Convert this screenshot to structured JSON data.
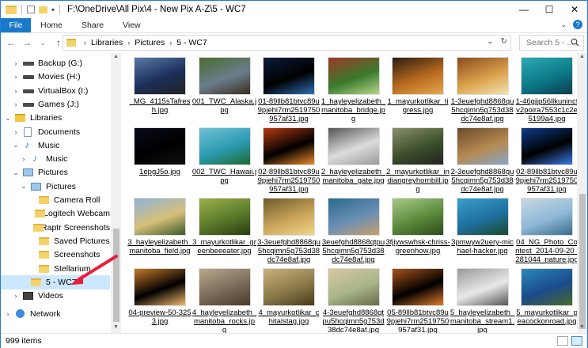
{
  "window": {
    "title": "F:\\OneDrive\\All Pix\\4 - New Pix A-Z\\5 - WC7",
    "minimize": "—",
    "maximize": "☐",
    "close": "✕"
  },
  "ribbon": {
    "tabs": [
      "File",
      "Home",
      "Share",
      "View"
    ]
  },
  "address": {
    "crumbs": [
      "Libraries",
      "Pictures",
      "5 - WC7"
    ],
    "search_placeholder": "Search 5 - ..."
  },
  "nav": {
    "items": [
      {
        "label": "Backup (G:)",
        "icon": "drive-icon",
        "chev": "›",
        "indent": 1
      },
      {
        "label": "Movies (H:)",
        "icon": "drive-icon",
        "chev": "›",
        "indent": 1
      },
      {
        "label": "VirtualBox (I:)",
        "icon": "drive-icon",
        "chev": "›",
        "indent": 1
      },
      {
        "label": "Games (J:)",
        "icon": "drive-icon",
        "chev": "›",
        "indent": 1
      },
      {
        "label": "Libraries",
        "icon": "libraries-icon",
        "chev": "⌄",
        "indent": 0
      },
      {
        "label": "Documents",
        "icon": "documents-icon",
        "chev": "›",
        "indent": 1
      },
      {
        "label": "Music",
        "icon": "music-icon",
        "chev": "⌄",
        "indent": 1
      },
      {
        "label": "Music",
        "icon": "music-icon",
        "chev": "›",
        "indent": 2
      },
      {
        "label": "Pictures",
        "icon": "pictures-icon",
        "chev": "⌄",
        "indent": 1
      },
      {
        "label": "Pictures",
        "icon": "pictures-icon",
        "chev": "⌄",
        "indent": 2
      },
      {
        "label": "Camera Roll",
        "icon": "folder-icon",
        "chev": "",
        "indent": 3
      },
      {
        "label": "Logitech Webcam",
        "icon": "folder-icon",
        "chev": "",
        "indent": 3
      },
      {
        "label": "Raptr Screenshots",
        "icon": "folder-icon",
        "chev": "",
        "indent": 3
      },
      {
        "label": "Saved Pictures",
        "icon": "folder-icon",
        "chev": "",
        "indent": 3
      },
      {
        "label": "Screenshots",
        "icon": "folder-icon",
        "chev": "",
        "indent": 3
      },
      {
        "label": "Stellarium",
        "icon": "folder-icon",
        "chev": "",
        "indent": 3
      },
      {
        "label": "5 - WC7",
        "icon": "folder-icon",
        "chev": "",
        "indent": 2,
        "selected": true
      },
      {
        "label": "Videos",
        "icon": "videos-icon",
        "chev": "›",
        "indent": 1
      },
      {
        "label": "Network",
        "icon": "network-icon",
        "chev": "›",
        "indent": 0
      }
    ]
  },
  "files": [
    {
      "name": "_MG_4115sTafresh.jpg",
      "colors": [
        "#1b2f5a",
        "#5a79a8",
        "#222"
      ]
    },
    {
      "name": "001_TWC_Alaska.jpg",
      "colors": [
        "#6a7d8c",
        "#4b6b2f",
        "#3a2e1e"
      ]
    },
    {
      "name": "01-89llb81btvc89u9pjehi7rm2519750957af31.jpg",
      "colors": [
        "#000",
        "#0c1d3d",
        "#2e6fb5"
      ]
    },
    {
      "name": "1_hayleyelizabeth_manitoba_bridge.jpg",
      "colors": [
        "#3a7a2c",
        "#9b3a2a",
        "#b7d68a"
      ]
    },
    {
      "name": "1_mayurkotlikar_tigress.jpg",
      "colors": [
        "#b86a1f",
        "#2a1c10",
        "#e6a94f"
      ]
    },
    {
      "name": "1-3euefghd8868qu5hcqimn5g753d38dc74e8af.jpg",
      "colors": [
        "#d9a14b",
        "#8c4a1e",
        "#f5e1b0"
      ]
    },
    {
      "name": "1-46gjip56llkunincfv2poira7553c1c2e5199a4.jpg",
      "colors": [
        "#0b7a86",
        "#2ea8b6",
        "#0f3b52"
      ]
    },
    {
      "name": "1epgJ5o.jpg",
      "colors": [
        "#000",
        "#0a0a1a",
        "#111"
      ]
    },
    {
      "name": "002_TWC_Hawaii.jpg",
      "colors": [
        "#2a9ab0",
        "#73c1d8",
        "#1d6b2f"
      ]
    },
    {
      "name": "02-89llb81btvc89u9pjehi7rm2519750957af31.jpg",
      "colors": [
        "#000",
        "#b43a12",
        "#ee8a2a"
      ]
    },
    {
      "name": "2_hayleyelizabeth_manitoba_gate.jpg",
      "colors": [
        "#dcdcdc",
        "#555",
        "#9a9a9a"
      ]
    },
    {
      "name": "2_mayurkotlikar_indiangreyhornbill.jpg",
      "colors": [
        "#3b4f2a",
        "#8a8f6b",
        "#222"
      ]
    },
    {
      "name": "2-3euefghd8868qu5hcqimn5g753d38dc74e8af.jpg",
      "colors": [
        "#b58a52",
        "#6b4b2a",
        "#87a6c8"
      ]
    },
    {
      "name": "02-89llb81btvc89u9pjehi7rm2519750957af31.jpg",
      "colors": [
        "#000",
        "#0e3d8c",
        "#3b7be6"
      ]
    },
    {
      "name": "3_hayleyelizabeth_manitoba_field.jpg",
      "colors": [
        "#d6c07a",
        "#8fb3d8",
        "#3a5a2a"
      ]
    },
    {
      "name": "3_mayurkotlikar_greenbeeeater.jpg",
      "colors": [
        "#5b7a2a",
        "#9ab04a",
        "#2a3a12"
      ]
    },
    {
      "name": "3-3euefghd8868qu5hcqimn5g753d38dc74e8af.jpg",
      "colors": [
        "#c9a45a",
        "#6d5a2a",
        "#f1d68a"
      ]
    },
    {
      "name": "3euefghd8868qtpu5hcqimn5g753d38dc74e8af.jpg",
      "colors": [
        "#6b8fb5",
        "#2a6a8a",
        "#c6a06a"
      ]
    },
    {
      "name": "3fjiywswhsk-chriss-greenhow.jpg",
      "colors": [
        "#5a8a3a",
        "#a9c98a",
        "#2d4a1a"
      ]
    },
    {
      "name": "3pmwyw2uery-michael-hacker.jpg",
      "colors": [
        "#1f6fa0",
        "#38a0c8",
        "#1a4a2a"
      ]
    },
    {
      "name": "04_NG_Photo_Contest_2014-09-20_281044_nature.jpg",
      "colors": [
        "#8fb9d8",
        "#c8d7e0",
        "#3a6a8a"
      ]
    },
    {
      "name": "04-preview-50-3253.jpg",
      "colors": [
        "#000",
        "#c57a2a",
        "#f3b86a"
      ]
    },
    {
      "name": "4_hayleyelizabeth_manitoba_rocks.jpg",
      "colors": [
        "#7a6a5a",
        "#b8a88a",
        "#4a3a2a"
      ]
    },
    {
      "name": "4_mayurkotlikar_chitalstag.jpg",
      "colors": [
        "#8a7a4a",
        "#c9b07a",
        "#4a3a1a"
      ]
    },
    {
      "name": "4-3euefghd8868qtpu5hcqimn5g753d38dc74e8af.jpg",
      "colors": [
        "#a8b58a",
        "#d9c8a0",
        "#6a6a4a"
      ]
    },
    {
      "name": "05-89llb81btvc89u9pjehi7rm2519750957af31.jpg",
      "colors": [
        "#000",
        "#a8531a",
        "#e07a2a"
      ]
    },
    {
      "name": "5_hayleyelizabeth_manitoba_stream1.jpg",
      "colors": [
        "#e8e8e8",
        "#9a9a9a",
        "#555"
      ]
    },
    {
      "name": "5_mayurkotlikar_peacockonroad.jpg",
      "colors": [
        "#1a4a8a",
        "#2a8ab8",
        "#4a6a2a"
      ]
    }
  ],
  "status": {
    "count": "999 items"
  },
  "colors": {
    "accent": "#1979ca",
    "selection": "#cce8ff",
    "annotation_arrow": "#e8213a"
  }
}
